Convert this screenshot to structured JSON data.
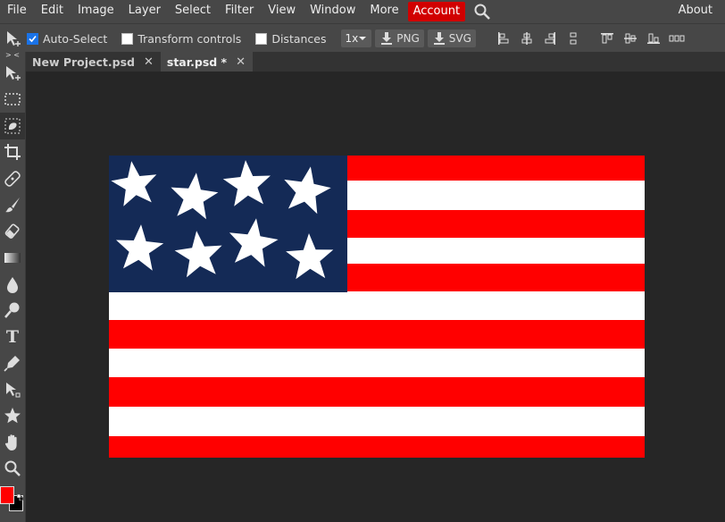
{
  "menu": {
    "items": [
      "File",
      "Edit",
      "Image",
      "Layer",
      "Select",
      "Filter",
      "View",
      "Window",
      "More"
    ],
    "account": "Account",
    "about": "About"
  },
  "options": {
    "auto_select": "Auto-Select",
    "transform_controls": "Transform controls",
    "distances": "Distances",
    "scale": "1x",
    "png": "PNG",
    "svg": "SVG"
  },
  "tabs": [
    {
      "label": "New Project.psd",
      "close": "✕"
    },
    {
      "label": "star.psd *",
      "close": "✕"
    }
  ],
  "tools": [
    "move-tool-icon",
    "marquee-tool-icon",
    "lasso-tool-icon",
    "crop-tool-icon",
    "healing-tool-icon",
    "brush-tool-icon",
    "eraser-tool-icon",
    "gradient-tool-icon",
    "blur-tool-icon",
    "dodge-tool-icon",
    "type-tool-icon",
    "pen-tool-icon",
    "path-select-tool-icon",
    "shape-tool-icon",
    "hand-tool-icon",
    "zoom-tool-icon"
  ],
  "type_tool_glyph": "T",
  "colors": {
    "foreground": "#ff0000",
    "background": "#000000",
    "accent": "#d10000",
    "flag_red": "#ff0000",
    "flag_blue": "#142a56"
  }
}
